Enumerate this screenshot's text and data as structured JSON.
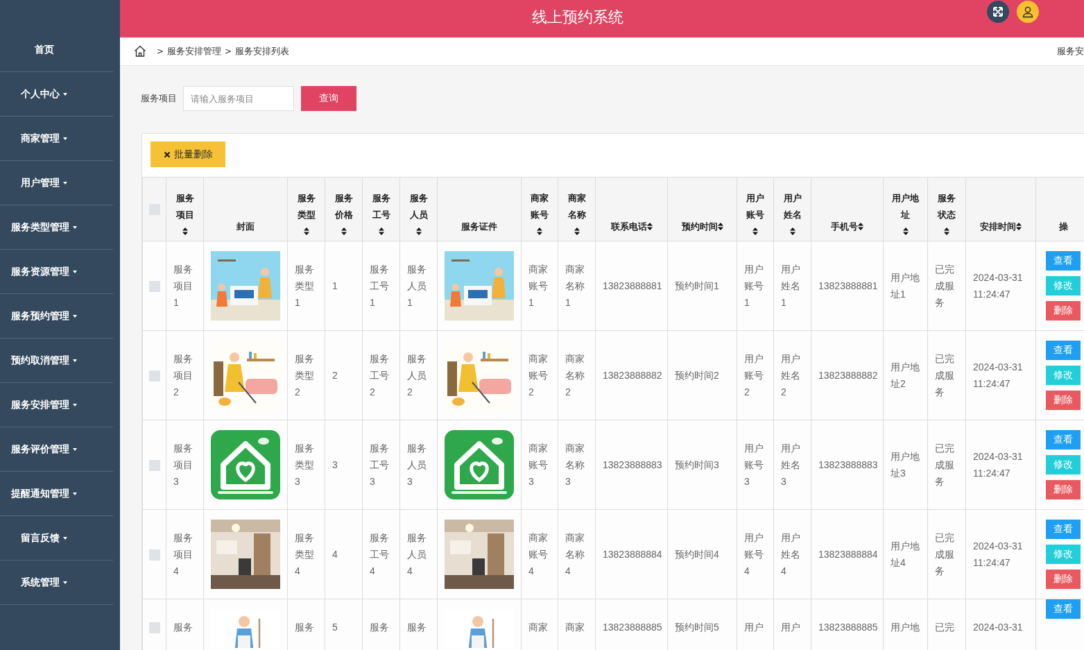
{
  "header": {
    "title": "线上预约系统"
  },
  "sidebar": {
    "items": [
      {
        "label": "首页",
        "has_submenu": false
      },
      {
        "label": "个人中心",
        "has_submenu": true
      },
      {
        "label": "商家管理",
        "has_submenu": true
      },
      {
        "label": "用户管理",
        "has_submenu": true
      },
      {
        "label": "服务类型管理",
        "has_submenu": true
      },
      {
        "label": "服务资源管理",
        "has_submenu": true
      },
      {
        "label": "服务预约管理",
        "has_submenu": true
      },
      {
        "label": "预约取消管理",
        "has_submenu": true
      },
      {
        "label": "服务安排管理",
        "has_submenu": true
      },
      {
        "label": "服务评价管理",
        "has_submenu": true
      },
      {
        "label": "提醒通知管理",
        "has_submenu": true
      },
      {
        "label": "留言反馈",
        "has_submenu": true
      },
      {
        "label": "系统管理",
        "has_submenu": true
      }
    ]
  },
  "breadcrumb": {
    "separator": ">",
    "items": [
      "服务安排管理",
      "服务安排列表"
    ],
    "right_text": "服务安"
  },
  "search": {
    "label": "服务项目",
    "placeholder": "请输入服务项目",
    "button": "查询"
  },
  "toolbar": {
    "batch_delete": "批量删除"
  },
  "table": {
    "header_checkbox": {
      "checked": false
    },
    "columns": [
      {
        "label": "服务项目",
        "kind": "text"
      },
      {
        "label": "封面"
      },
      {
        "label": "服务类型",
        "kind": "text"
      },
      {
        "label": "服务价格",
        "kind": "text"
      },
      {
        "label": "服务工号",
        "kind": "text"
      },
      {
        "label": "服务人员",
        "kind": "text"
      },
      {
        "label": "服务证件"
      },
      {
        "label": "商家账号",
        "kind": "text"
      },
      {
        "label": "商家名称",
        "kind": "text"
      },
      {
        "label": "联系电话",
        "kind": "text"
      },
      {
        "label": "预约时间",
        "kind": "text"
      },
      {
        "label": "用户账号",
        "kind": "text"
      },
      {
        "label": "用户姓名",
        "kind": "text"
      },
      {
        "label": "手机号",
        "kind": "text"
      },
      {
        "label": "用户地址",
        "kind": "text"
      },
      {
        "label": "服务状态",
        "kind": "text"
      },
      {
        "label": "安排时间",
        "kind": "text"
      },
      {
        "label": "操",
        "kind": "actions"
      }
    ],
    "rows": [
      {
        "checked": false,
        "cells": [
          "服务项目1",
          {
            "kind": "picture"
          },
          "服务类型1",
          "1",
          "服务工号1",
          "服务人员1",
          {
            "kind": "picture"
          },
          "商家账号1",
          "商家名称1",
          "13823888881",
          "预约时间1",
          "用户账号1",
          "用户姓名1",
          "13823888881",
          "用户地址1",
          "已完成服务",
          "2024-03-31 11:24:47",
          [
            {
              "label": "查看",
              "kind": "view"
            },
            {
              "label": "修改",
              "kind": "edit"
            },
            {
              "label": "删除",
              "kind": "delete"
            }
          ]
        ]
      },
      {
        "checked": false,
        "cells": [
          "服务项目2",
          {
            "kind": "picture"
          },
          "服务类型2",
          "2",
          "服务工号2",
          "服务人员2",
          {
            "kind": "picture"
          },
          "商家账号2",
          "商家名称2",
          "13823888882",
          "预约时间2",
          "用户账号2",
          "用户姓名2",
          "13823888882",
          "用户地址2",
          "已完成服务",
          "2024-03-31 11:24:47",
          [
            {
              "label": "查看",
              "kind": "view"
            },
            {
              "label": "修改",
              "kind": "edit"
            },
            {
              "label": "删除",
              "kind": "delete"
            }
          ]
        ]
      },
      {
        "checked": false,
        "cells": [
          "服务项目3",
          {
            "kind": "picture"
          },
          "服务类型3",
          "3",
          "服务工号3",
          "服务人员3",
          {
            "kind": "picture"
          },
          "商家账号3",
          "商家名称3",
          "13823888883",
          "预约时间3",
          "用户账号3",
          "用户姓名3",
          "13823888883",
          "用户地址3",
          "已完成服务",
          "2024-03-31 11:24:47",
          [
            {
              "label": "查看",
              "kind": "view"
            },
            {
              "label": "修改",
              "kind": "edit"
            },
            {
              "label": "删除",
              "kind": "delete"
            }
          ]
        ]
      },
      {
        "checked": false,
        "cells": [
          "服务项目4",
          {
            "kind": "picture"
          },
          "服务类型4",
          "4",
          "服务工号4",
          "服务人员4",
          {
            "kind": "picture"
          },
          "商家账号4",
          "商家名称4",
          "13823888884",
          "预约时间4",
          "用户账号4",
          "用户姓名4",
          "13823888884",
          "用户地址4",
          "已完成服务",
          "2024-03-31 11:24:47",
          [
            {
              "label": "查看",
              "kind": "view"
            },
            {
              "label": "修改",
              "kind": "edit"
            },
            {
              "label": "删除",
              "kind": "delete"
            }
          ]
        ]
      },
      {
        "checked": false,
        "cells": [
          "服务",
          {
            "kind": "picture"
          },
          "服务",
          "5",
          "服务",
          "服务",
          {
            "kind": "picture"
          },
          "商家",
          "商家",
          "13823888885",
          "预约时间5",
          "用户",
          "用户",
          "13823888885",
          "用户地",
          "已完",
          "2024-03-31",
          [
            {
              "label": "查看",
              "kind": "view"
            }
          ]
        ]
      }
    ]
  }
}
